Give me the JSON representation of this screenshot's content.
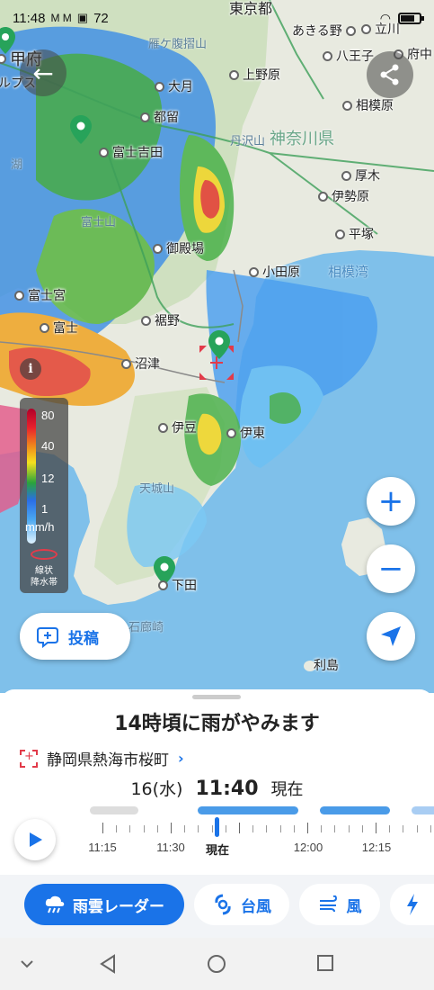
{
  "status_bar": {
    "time": "11:48",
    "notif": "M M",
    "temp": "72",
    "battery_level": 0.75
  },
  "map": {
    "places": [
      {
        "name": "甲府",
        "id": "kofu"
      },
      {
        "name": "あきる野",
        "id": "akiruno"
      },
      {
        "name": "立川",
        "id": "tachikawa"
      },
      {
        "name": "八王子",
        "id": "hachioji"
      },
      {
        "name": "府中",
        "id": "fuchu"
      },
      {
        "name": "大月",
        "id": "otsuki"
      },
      {
        "name": "上野原",
        "id": "uenohara"
      },
      {
        "name": "都留",
        "id": "tsuru"
      },
      {
        "name": "相模原",
        "id": "sagamihara"
      },
      {
        "name": "富士吉田",
        "id": "fujiyoshida"
      },
      {
        "name": "厚木",
        "id": "atsugi"
      },
      {
        "name": "伊勢原",
        "id": "isehara"
      },
      {
        "name": "平塚",
        "id": "hiratsuka"
      },
      {
        "name": "御殿場",
        "id": "gotemba"
      },
      {
        "name": "小田原",
        "id": "odawara"
      },
      {
        "name": "富士宮",
        "id": "fujinomiya"
      },
      {
        "name": "富士",
        "id": "fuji"
      },
      {
        "name": "裾野",
        "id": "susono"
      },
      {
        "name": "沼津",
        "id": "numazu"
      },
      {
        "name": "伊豆",
        "id": "izu"
      },
      {
        "name": "伊東",
        "id": "ito"
      },
      {
        "name": "下田",
        "id": "shimoda"
      },
      {
        "name": "利島",
        "id": "toshima"
      }
    ],
    "prefecture_label": "神奈川県",
    "city_label": "東京都",
    "alps_label": "ルプス",
    "mountains": {
      "daibosatsu": "雁ケ腹摺山",
      "tanzawa": "丹沢山",
      "fujisan": "富士山",
      "amagi": "天城山",
      "irozaki": "石廊崎"
    },
    "lake_label": "湖",
    "sea_label": "相模湾"
  },
  "legend": {
    "levels": [
      "80",
      "40",
      "12",
      "1"
    ],
    "unit": "mm/h",
    "band_line1": "線状",
    "band_line2": "降水帯"
  },
  "buttons": {
    "post_label": "投稿",
    "zoom_in": "+",
    "zoom_out": "−",
    "info": "i"
  },
  "sheet": {
    "headline": "14時頃に雨がやみます",
    "location": "静岡県熱海市桜町",
    "date": "16(水)",
    "time": "11:40",
    "now_label": "現在"
  },
  "timeline": {
    "labels": [
      "11:15",
      "11:30",
      "現在",
      "12:00",
      "12:15"
    ],
    "current_label": "現在"
  },
  "tabs": [
    {
      "label": "雨雲レーダー",
      "active": true,
      "icon": "rain-cloud-icon"
    },
    {
      "label": "台風",
      "active": false,
      "icon": "typhoon-icon"
    },
    {
      "label": "風",
      "active": false,
      "icon": "wind-icon"
    },
    {
      "label": "",
      "active": false,
      "icon": "lightning-icon"
    }
  ],
  "colors": {
    "accent": "#1a73e8",
    "pin": "#27a35a",
    "marker": "#e23b4a"
  }
}
